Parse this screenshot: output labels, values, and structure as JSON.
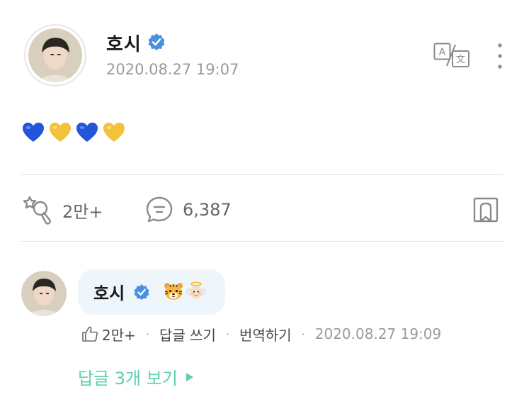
{
  "post": {
    "author": "호시",
    "timestamp": "2020.08.27 19:07",
    "body_emojis": [
      "blue-heart",
      "yellow-heart",
      "blue-heart",
      "yellow-heart"
    ],
    "likes": "2만+",
    "comments": "6,387"
  },
  "reply": {
    "author": "호시",
    "emojis": [
      "tiger-face",
      "baby-angel"
    ],
    "likes": "2만+",
    "reply_label": "답글 쓰기",
    "translate_label": "번역하기",
    "separator": "·",
    "timestamp": "2020.08.27 19:09",
    "view_replies": "답글 3개 보기"
  },
  "colors": {
    "verified": "#4a90e2",
    "accent_green": "#5ccfb0",
    "bubble_bg": "#eef6fb",
    "blue_heart": "#2255d8",
    "yellow_heart": "#f3c13a"
  }
}
